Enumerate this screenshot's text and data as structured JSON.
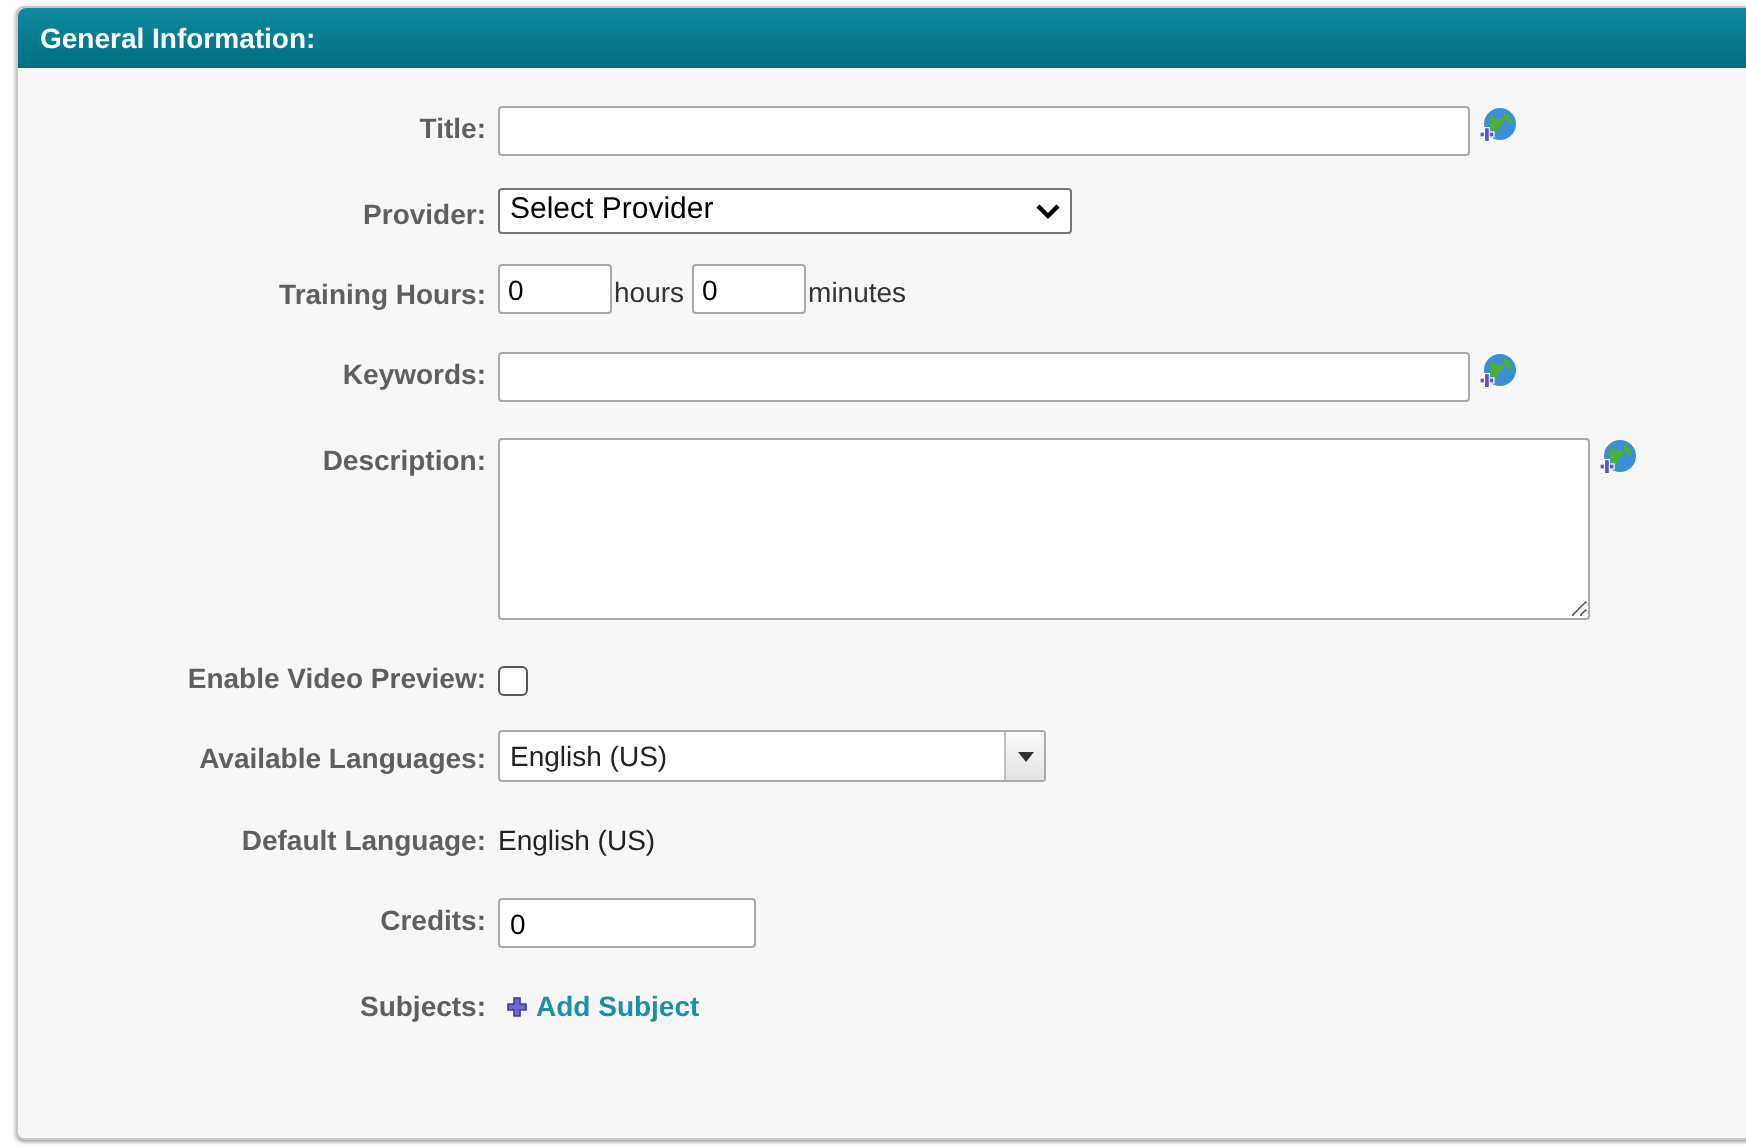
{
  "panel": {
    "title": "General Information:"
  },
  "fields": [
    {
      "kind": "text",
      "label": "Title:",
      "translate": true
    },
    {
      "kind": "select",
      "label": "Provider:",
      "value": "Select Provider"
    },
    {
      "kind": "duration",
      "label": "Training Hours:",
      "hours": "0",
      "hours_unit": "hours",
      "minutes": "0",
      "minutes_unit": "minutes"
    },
    {
      "kind": "text",
      "label": "Keywords:",
      "translate": true
    },
    {
      "kind": "textarea",
      "label": "Description:",
      "translate": true
    },
    {
      "kind": "checkbox",
      "label": "Enable Video Preview:",
      "checked": false
    },
    {
      "kind": "combo",
      "label": "Available Languages:",
      "value": "English (US)"
    },
    {
      "kind": "static",
      "label": "Default Language:",
      "value": "English (US)"
    },
    {
      "kind": "short",
      "label": "Credits:",
      "value": "0"
    },
    {
      "kind": "link",
      "label": "Subjects:",
      "value": "Add Subject"
    }
  ]
}
